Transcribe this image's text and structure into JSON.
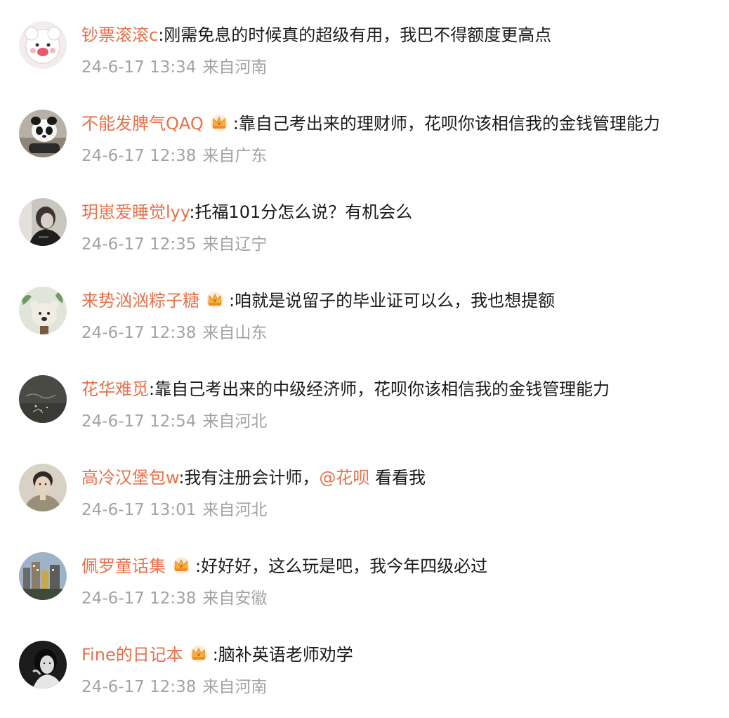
{
  "comments": [
    {
      "username": "钞票滚滚c",
      "colon": ":",
      "crown": false,
      "text": "刚需免息的时候真的超级有用，我巴不得额度更高点",
      "mention": "",
      "text_after": "",
      "time": "24-6-17 13:34",
      "location": "来自河南"
    },
    {
      "username": "不能发脾气QAQ",
      "colon": ":",
      "crown": true,
      "text": "靠自己考出来的理财师，花呗你该相信我的金钱管理能力",
      "mention": "",
      "text_after": "",
      "time": "24-6-17 12:38",
      "location": "来自广东"
    },
    {
      "username": "玥崽爱睡觉lyy",
      "colon": ":",
      "crown": false,
      "text": "托福101分怎么说？有机会么",
      "mention": "",
      "text_after": "",
      "time": "24-6-17 12:35",
      "location": "来自辽宁"
    },
    {
      "username": "来势汹汹粽子糖",
      "colon": ":",
      "crown": true,
      "text": "咱就是说留子的毕业证可以么，我也想提额",
      "mention": "",
      "text_after": "",
      "time": "24-6-17 12:38",
      "location": "来自山东"
    },
    {
      "username": "花华难觅",
      "colon": ":",
      "crown": false,
      "text": "靠自己考出来的中级经济师，花呗你该相信我的金钱管理能力",
      "mention": "",
      "text_after": "",
      "time": "24-6-17 12:54",
      "location": "来自河北"
    },
    {
      "username": "高冷汉堡包w",
      "colon": ":",
      "crown": false,
      "text": "我有注册会计师，",
      "mention": "@花呗",
      "text_after": " 看看我",
      "time": "24-6-17 13:01",
      "location": "来自河北"
    },
    {
      "username": "佩罗童话集",
      "colon": ":",
      "crown": true,
      "text": "好好好，这么玩是吧，我今年四级必过",
      "mention": "",
      "text_after": "",
      "time": "24-6-17 12:38",
      "location": "来自安徽"
    },
    {
      "username": "Fine的日记本",
      "colon": ":",
      "crown": true,
      "text": "脑补英语老师劝学",
      "mention": "",
      "text_after": "",
      "time": "24-6-17 12:38",
      "location": "来自河南"
    }
  ],
  "colors": {
    "username": "#e8704a",
    "text": "#1a1a1a",
    "meta": "#a3a3a3",
    "background": "#ffffff"
  },
  "icons": {
    "crown": "crown-icon",
    "avatar": "avatar-image"
  }
}
